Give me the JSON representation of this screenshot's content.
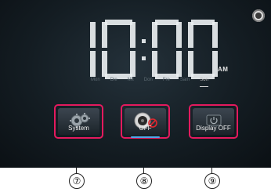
{
  "clock": {
    "hours": "10",
    "minutes": "00",
    "ampm": "AM",
    "days": [
      "Mon",
      "Die",
      "Mit",
      "Don",
      "Fre",
      "Sam",
      "Son"
    ],
    "active_day": "Son"
  },
  "buttons": [
    {
      "label": "System",
      "icon": "gear-icon",
      "selected": false
    },
    {
      "label": "OFF",
      "icon": "speaker-mute-icon",
      "selected": true
    },
    {
      "label": "Display OFF",
      "icon": "power-icon",
      "selected": false
    }
  ],
  "callouts": [
    "⑦",
    "⑧",
    "⑨"
  ],
  "colors": {
    "highlight": "#e41a5e",
    "selection_bar": "#4fa8e8",
    "background": "#141d23"
  }
}
